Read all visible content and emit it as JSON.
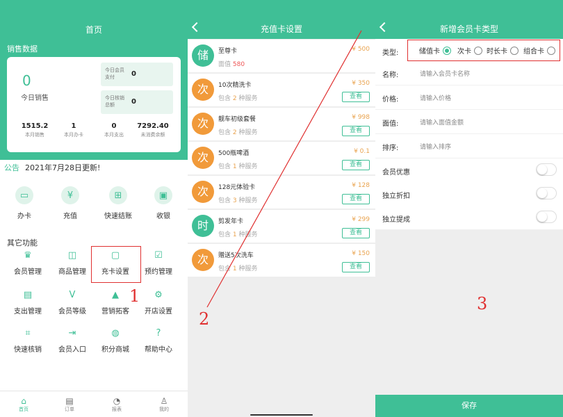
{
  "colors": {
    "brand": "#3fbf96",
    "accent_orange": "#f19a3a",
    "annotation_red": "#e03030"
  },
  "home": {
    "title": "首页",
    "sales_label": "销售数据",
    "today_sales_value": "0",
    "today_sales_label": "今日销售",
    "box1_label": "今日会员支付",
    "box1_value": "0",
    "box2_label": "今日核销总额",
    "box2_value": "0",
    "stats": [
      {
        "value": "1515.2",
        "label": "本月销售"
      },
      {
        "value": "1",
        "label": "本月办卡"
      },
      {
        "value": "0",
        "label": "本月支出"
      },
      {
        "value": "7292.40",
        "label": "未消费余额"
      }
    ],
    "notice_key": "公告",
    "notice_text": "2021年7月28日更新!",
    "quick": [
      {
        "label": "办卡",
        "icon": "card-icon"
      },
      {
        "label": "充值",
        "icon": "yen-icon"
      },
      {
        "label": "快速结账",
        "icon": "calculator-icon"
      },
      {
        "label": "收银",
        "icon": "cashier-icon"
      }
    ],
    "other_label": "其它功能",
    "grid": [
      {
        "label": "会员管理",
        "icon": "crown-icon"
      },
      {
        "label": "商品管理",
        "icon": "bag-icon"
      },
      {
        "label": "充卡设置",
        "icon": "wallet-icon"
      },
      {
        "label": "预约管理",
        "icon": "calendar-check-icon"
      },
      {
        "label": "支出管理",
        "icon": "money-icon"
      },
      {
        "label": "会员等级",
        "icon": "shield-v-icon"
      },
      {
        "label": "营销拓客",
        "icon": "growth-icon"
      },
      {
        "label": "开店设置",
        "icon": "gear-icon"
      },
      {
        "label": "快速核销",
        "icon": "scan-icon"
      },
      {
        "label": "会员入口",
        "icon": "login-icon"
      },
      {
        "label": "积分商城",
        "icon": "piggy-icon"
      },
      {
        "label": "帮助中心",
        "icon": "help-icon"
      }
    ],
    "tabs": [
      {
        "label": "首页",
        "icon": "home-icon"
      },
      {
        "label": "订单",
        "icon": "order-icon"
      },
      {
        "label": "报表",
        "icon": "pie-chart-icon"
      },
      {
        "label": "我的",
        "icon": "user-icon"
      }
    ],
    "annotation": "1"
  },
  "cards": {
    "title": "充值卡设置",
    "annotation": "2",
    "view_label": "查看",
    "items": [
      {
        "badge": "储",
        "name": "至尊卡",
        "sub_prefix": "面值 ",
        "sub_num": "580",
        "sub_suffix": "",
        "price": "¥ 500",
        "color": "#3fbf96",
        "has_btn": false
      },
      {
        "badge": "次",
        "name": "10次精洗卡",
        "sub_prefix": "包含 ",
        "sub_num": "2",
        "sub_suffix": " 种服务",
        "price": "¥ 350",
        "color": "#f19a3a",
        "has_btn": true
      },
      {
        "badge": "次",
        "name": "靓车初级套餐",
        "sub_prefix": "包含 ",
        "sub_num": "2",
        "sub_suffix": " 种服务",
        "price": "¥ 998",
        "color": "#f19a3a",
        "has_btn": true
      },
      {
        "badge": "次",
        "name": "500瓶啤酒",
        "sub_prefix": "包含 ",
        "sub_num": "1",
        "sub_suffix": " 种服务",
        "price": "¥ 0.1",
        "color": "#f19a3a",
        "has_btn": true
      },
      {
        "badge": "次",
        "name": "128元体验卡",
        "sub_prefix": "包含 ",
        "sub_num": "3",
        "sub_suffix": " 种服务",
        "price": "¥ 128",
        "color": "#f19a3a",
        "has_btn": true
      },
      {
        "badge": "时",
        "name": "剪发年卡",
        "sub_prefix": "包含 ",
        "sub_num": "1",
        "sub_suffix": " 种服务",
        "price": "¥ 299",
        "color": "#3fbf96",
        "has_btn": true
      },
      {
        "badge": "次",
        "name": "赠送5次洗车",
        "sub_prefix": "包含 ",
        "sub_num": "1",
        "sub_suffix": " 种服务",
        "price": "¥ 150",
        "color": "#f19a3a",
        "has_btn": true
      }
    ]
  },
  "form": {
    "title": "新增会员卡类型",
    "annotation": "3",
    "type_label": "类型:",
    "types": [
      {
        "label": "储值卡",
        "checked": true
      },
      {
        "label": "次卡",
        "checked": false
      },
      {
        "label": "时长卡",
        "checked": false
      },
      {
        "label": "组合卡",
        "checked": false
      }
    ],
    "fields": [
      {
        "label": "名称:",
        "placeholder": "请输入会员卡名称"
      },
      {
        "label": "价格:",
        "placeholder": "请输入价格"
      },
      {
        "label": "面值:",
        "placeholder": "请输入面值金额"
      },
      {
        "label": "排序:",
        "placeholder": "请输入排序"
      }
    ],
    "toggles": [
      {
        "label": "会员优惠"
      },
      {
        "label": "独立折扣"
      },
      {
        "label": "独立提成"
      }
    ],
    "save_label": "保存"
  }
}
